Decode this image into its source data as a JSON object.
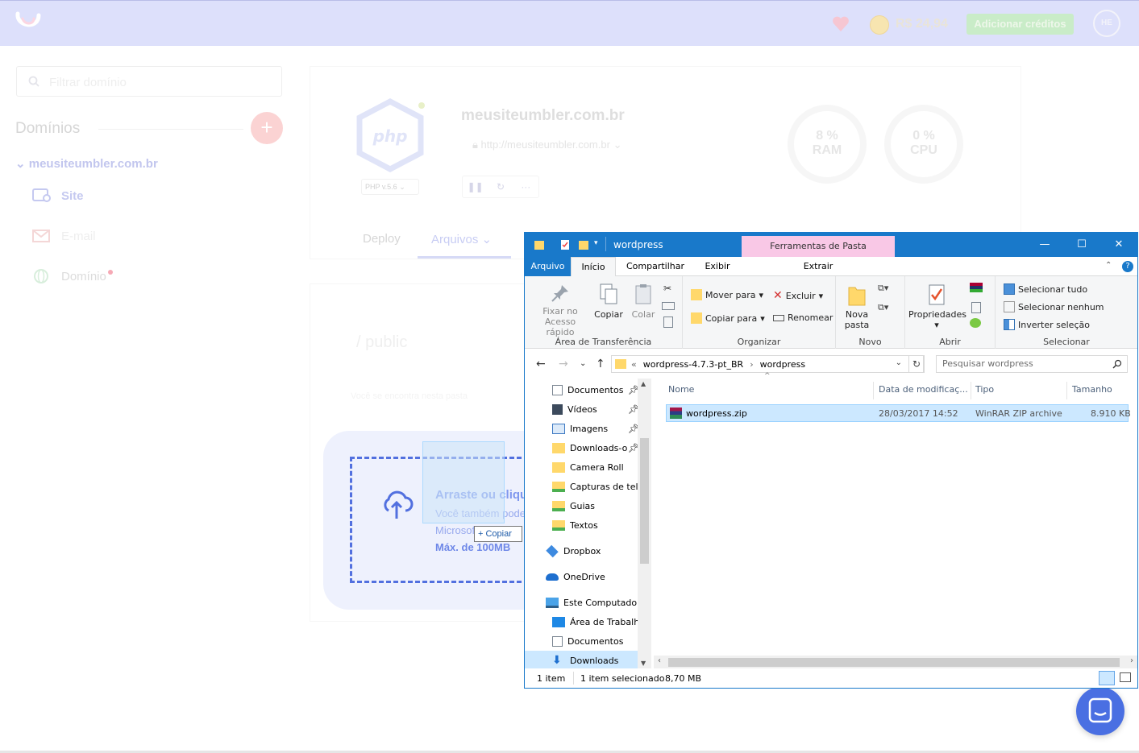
{
  "header": {
    "balance": "R$ 24,94",
    "add_credits": "Adicionar créditos",
    "avatar": "HE"
  },
  "sidebar": {
    "filter_placeholder": "Filtrar domínio",
    "domains_title": "Domínios",
    "add_label": "+",
    "site_domain": "meusiteumbler.com.br",
    "items": [
      {
        "label": "Site",
        "color": "#c5c9f0"
      },
      {
        "label": "E-mail",
        "color": "#f4d7d7"
      },
      {
        "label": "Domínio",
        "color": "#dcdcdc"
      }
    ]
  },
  "site_card": {
    "php_badge": "php",
    "php_version": "PHP v.5.6",
    "name": "meusiteumbler.com.br",
    "url": "http://meusiteumbler.com.br",
    "ram_pct": "8 %",
    "ram_label": "RAM",
    "cpu_pct": "0 %",
    "cpu_label": "CPU",
    "tabs": {
      "deploy": "Deploy",
      "files": "Arquivos"
    },
    "path": "/ public",
    "path_sub": "Você se encontra nesta pasta"
  },
  "upload": {
    "line1": "Arraste ou clique",
    "line2": "Você também pode",
    "line3": "Microsoft",
    "max": "Máx. de 100MB",
    "drag_copy": "+ Copiar",
    "accent": "#5270df"
  },
  "explorer": {
    "title": "wordpress",
    "context_tab_title": "Ferramentas de Pasta Compactada",
    "ribbon_tabs": [
      "Arquivo",
      "Início",
      "Compartilhar",
      "Exibir",
      "Extrair"
    ],
    "groups": {
      "clipboard": {
        "label": "Área de Transferência",
        "pin_line1": "Fixar no",
        "pin_line2": "Acesso rápido",
        "copy": "Copiar",
        "paste": "Colar"
      },
      "organize": {
        "label": "Organizar",
        "move": "Mover para",
        "copy_to": "Copiar para",
        "delete": "Excluir",
        "rename": "Renomear"
      },
      "new": {
        "label": "Novo",
        "new_folder_line1": "Nova",
        "new_folder_line2": "pasta"
      },
      "open": {
        "label": "Abrir",
        "properties": "Propriedades"
      },
      "select": {
        "label": "Selecionar",
        "select_all": "Selecionar tudo",
        "select_none": "Selecionar nenhum",
        "invert": "Inverter seleção"
      }
    },
    "address": {
      "root": "wordpress-4.7.3-pt_BR",
      "current": "wordpress",
      "search_placeholder": "Pesquisar wordpress"
    },
    "nav": [
      {
        "label": "Documentos",
        "icon": "documents-icon",
        "pinned": true
      },
      {
        "label": "Vídeos",
        "icon": "videos-icon",
        "pinned": true
      },
      {
        "label": "Imagens",
        "icon": "pictures-icon",
        "pinned": true
      },
      {
        "label": "Downloads-o",
        "icon": "folder-icon",
        "pinned": true
      },
      {
        "label": "Camera Roll",
        "icon": "folder-icon",
        "pinned": false
      },
      {
        "label": "Capturas de tela",
        "icon": "synced-folder-icon",
        "pinned": false
      },
      {
        "label": "Guias",
        "icon": "synced-folder-icon",
        "pinned": false
      },
      {
        "label": "Textos",
        "icon": "synced-folder-icon",
        "pinned": false
      },
      {
        "label": "Dropbox",
        "icon": "dropbox-icon",
        "pinned": false
      },
      {
        "label": "OneDrive",
        "icon": "onedrive-icon",
        "pinned": false
      },
      {
        "label": "Este Computador",
        "icon": "computer-icon",
        "pinned": false
      },
      {
        "label": "Área de Trabalho",
        "icon": "desktop-icon",
        "pinned": false
      },
      {
        "label": "Documentos",
        "icon": "documents-icon",
        "pinned": false
      },
      {
        "label": "Downloads",
        "icon": "downloads-icon",
        "pinned": false
      }
    ],
    "columns": [
      "Nome",
      "Data de modificaç...",
      "Tipo",
      "Tamanho"
    ],
    "files": [
      {
        "name": "wordpress.zip",
        "modified": "28/03/2017 14:52",
        "type": "WinRAR ZIP archive",
        "size": "8.910 KB"
      }
    ],
    "status": {
      "count": "1 item",
      "selected": "1 item selecionado",
      "size": "8,70 MB"
    }
  }
}
